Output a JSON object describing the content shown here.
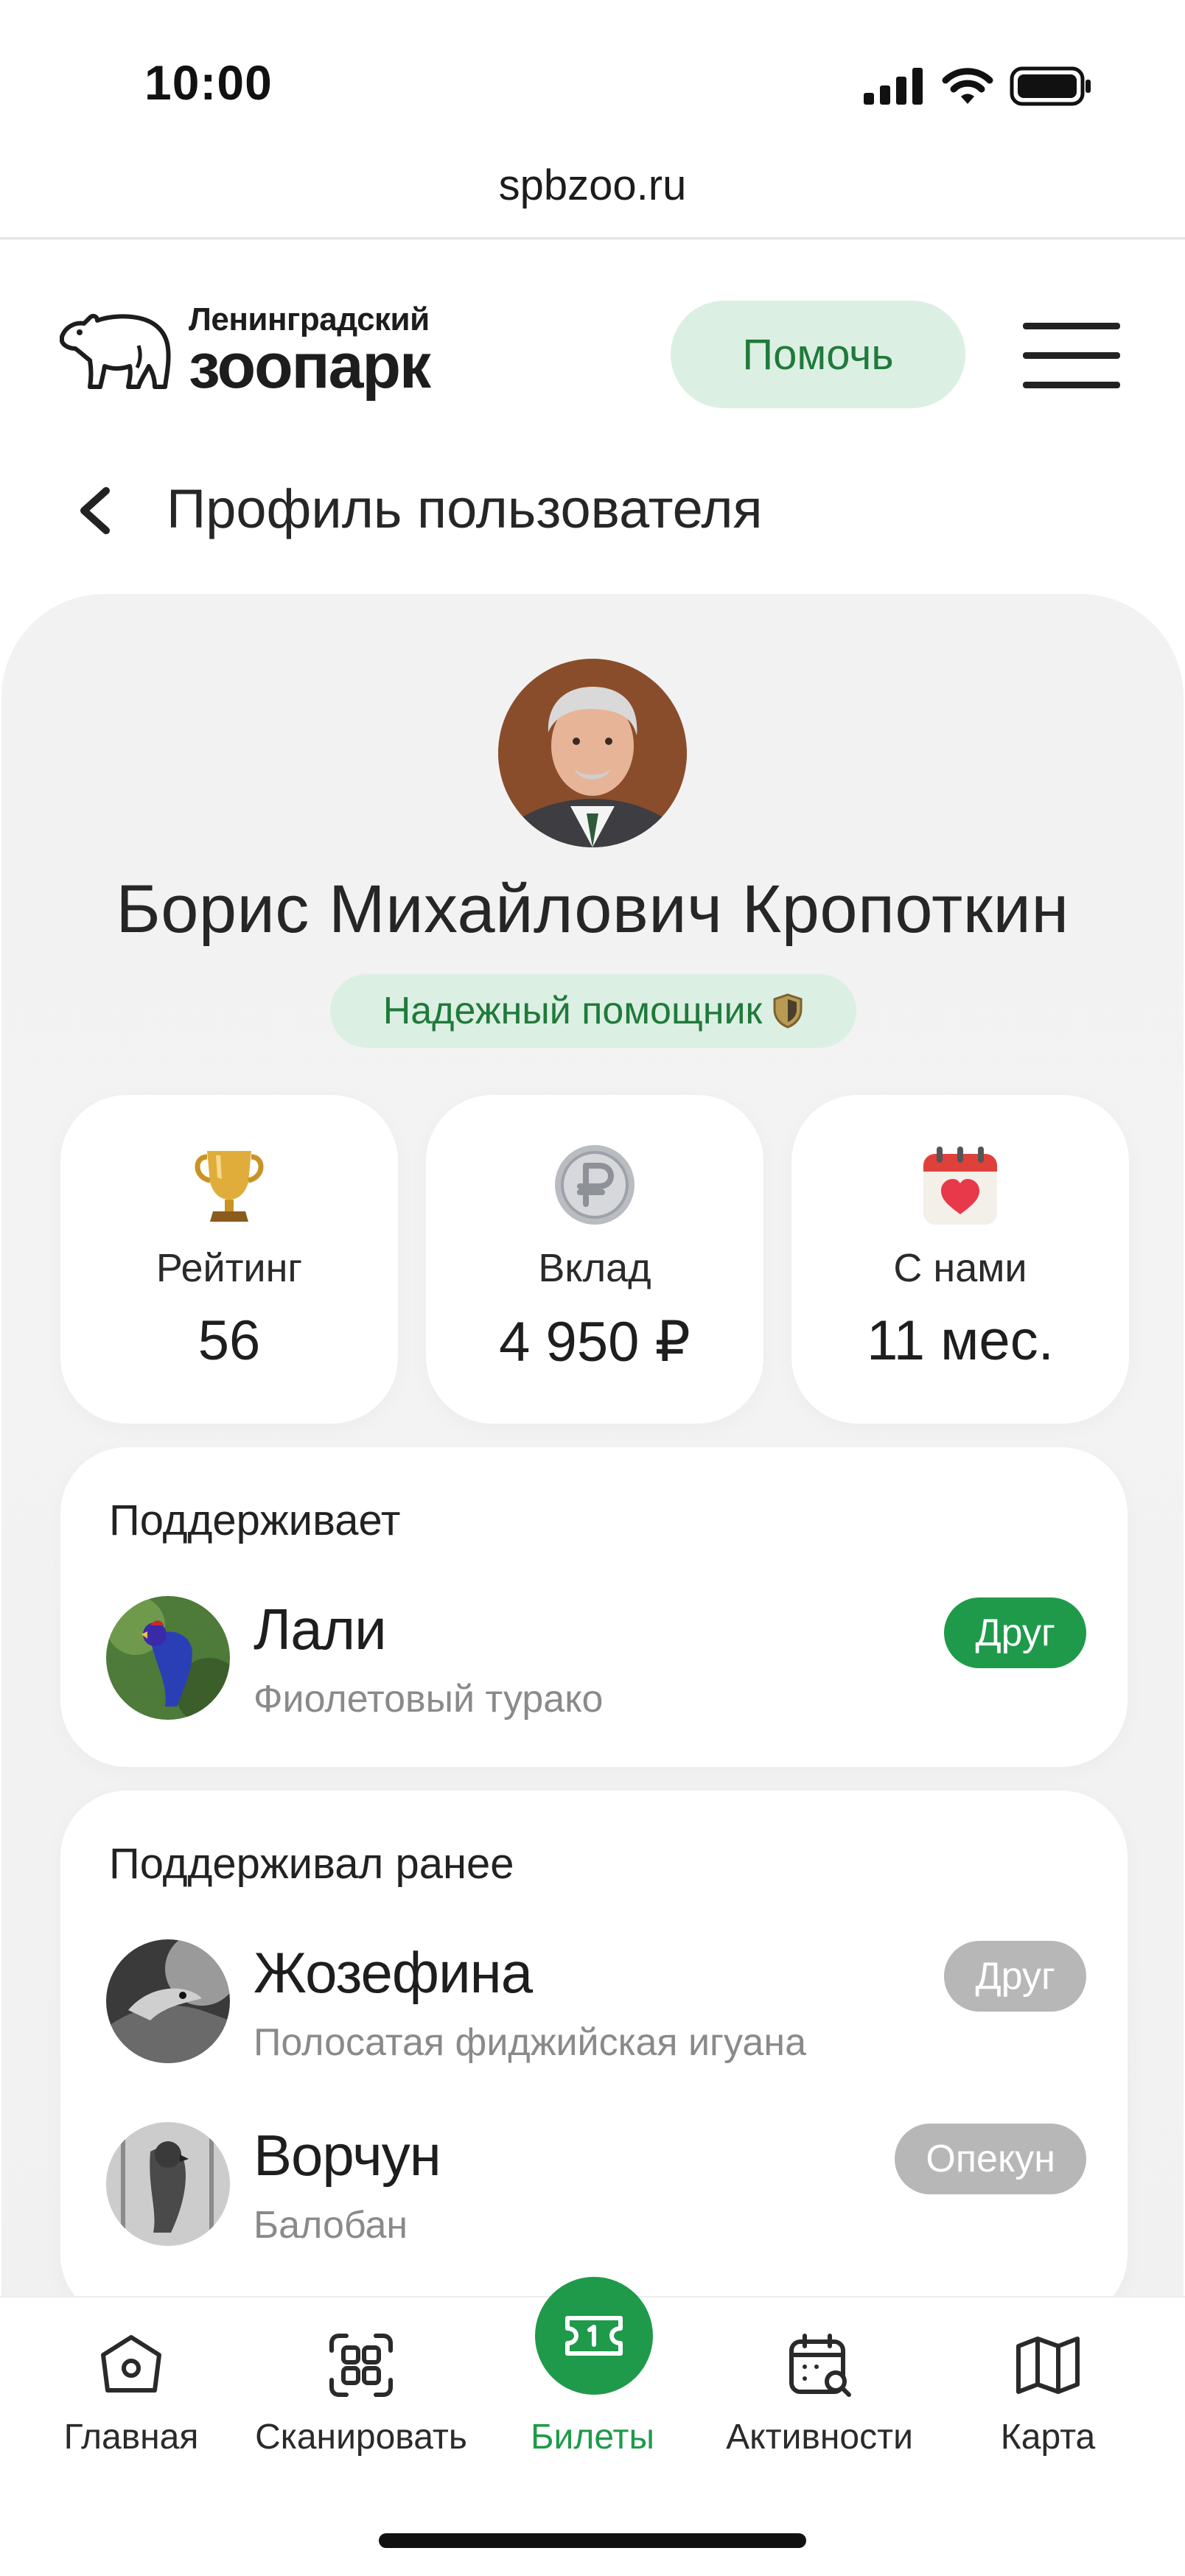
{
  "status_bar": {
    "time": "10:00"
  },
  "browser": {
    "url": "spbzoo.ru"
  },
  "header": {
    "logo_line1": "Ленинградский",
    "logo_line2": "зоопарк",
    "help_label": "Помочь"
  },
  "page": {
    "title": "Профиль пользователя"
  },
  "profile": {
    "name": "Борис Михайлович Кропоткин",
    "badge": "Надежный помощник"
  },
  "stats": [
    {
      "label": "Рейтинг",
      "value": "56",
      "icon": "trophy-icon"
    },
    {
      "label": "Вклад",
      "value": "4 950 ₽",
      "icon": "ruble-coin-icon"
    },
    {
      "label": "С нами",
      "value": "11 мес.",
      "icon": "calendar-heart-icon"
    }
  ],
  "supports": {
    "title": "Поддерживает",
    "items": [
      {
        "name": "Лали",
        "species": "Фиолетовый турако",
        "tag": "Друг"
      }
    ]
  },
  "supported_before": {
    "title": "Поддерживал ранее",
    "items": [
      {
        "name": "Жозефина",
        "species": "Полосатая фиджийская игуана",
        "tag": "Друг"
      },
      {
        "name": "Ворчун",
        "species": "Балобан",
        "tag": "Опекун"
      }
    ]
  },
  "nav": {
    "items": [
      {
        "label": "Главная",
        "icon": "home-icon"
      },
      {
        "label": "Сканировать",
        "icon": "scan-icon"
      },
      {
        "label": "Билеты",
        "icon": "ticket-icon",
        "active": true
      },
      {
        "label": "Активности",
        "icon": "calendar-search-icon"
      },
      {
        "label": "Карта",
        "icon": "map-icon"
      }
    ]
  },
  "colors": {
    "accent_green": "#1f9a4a",
    "soft_green": "#dcefe3",
    "tag_gray": "#b7b7b7"
  }
}
